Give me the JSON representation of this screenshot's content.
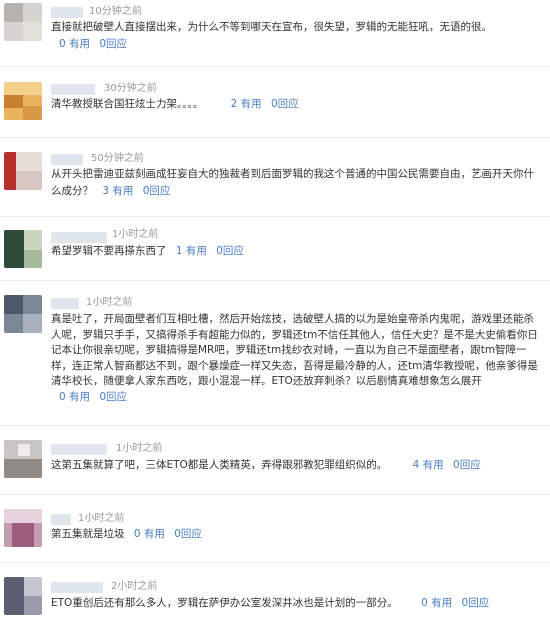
{
  "comments": [
    {
      "time": "10分钟之前",
      "text": "直接就把破壁人直接摆出来，为什么不等到哪天在宣布，很失望，罗辑的无能狂吼，无语的很。",
      "useful": "0 有用",
      "reply": "0回应"
    },
    {
      "time": "30分钟之前",
      "text": "清华教授联合国狂炫士力架。。。。",
      "useful": "2 有用",
      "reply": "0回应"
    },
    {
      "time": "50分钟之前",
      "text": "从开头把雷迪亚兹刻画成狂妄自大的独裁者到后面罗辑的我这个普通的中国公民需要自由，艺画开天你什么成分？",
      "useful": "3 有用",
      "reply": "0回应"
    },
    {
      "time": "1小时之前",
      "text": "希望罗辑不要再搽东西了",
      "useful": "1 有用",
      "reply": "0回应"
    },
    {
      "time": "1小时之前",
      "text": "真是吐了，开局面壁者们互相吐槽，然后开始炫技，选破壁人搞的以为是始皇帝杀内鬼呢，游戏里还能杀人呢，罗辑只手手，又搞得杀手有超能力似的，罗辑还tm不信任其他人，信任大史？是不是大史偷看你日记本让你很亲切呢，罗辑搞得是MR吧，罗辑还tm找纱衣对峙，一直以为自己不是面壁者，跟tm智障一样，连正常人智商都达不到，跟个暴燥症一样又失态，吾得是最冷静的人，还tm清华教授呢，他亲爹得是清华校长，随便拿人家东西吃，跟小混混一样。ETO还放弃刺杀？以后剧情真难想象怎么展开",
      "useful": "0 有用",
      "reply": "0回应"
    },
    {
      "time": "1小时之前",
      "text": "这第五集就算了吧，三体ETO都是人类精英，弄得跟邪教犯罪组织似的。",
      "useful": "4 有用",
      "reply": "0回应"
    },
    {
      "time": "1小时之前",
      "text": "第五集就是垃圾",
      "useful": "0 有用",
      "reply": "0回应"
    },
    {
      "time": "2小时之前",
      "text": "ETO重创后还有那么多人，罗辑在萨伊办公室发深井冰也是计划的一部分。",
      "useful": "0 有用",
      "reply": "0回应"
    }
  ]
}
